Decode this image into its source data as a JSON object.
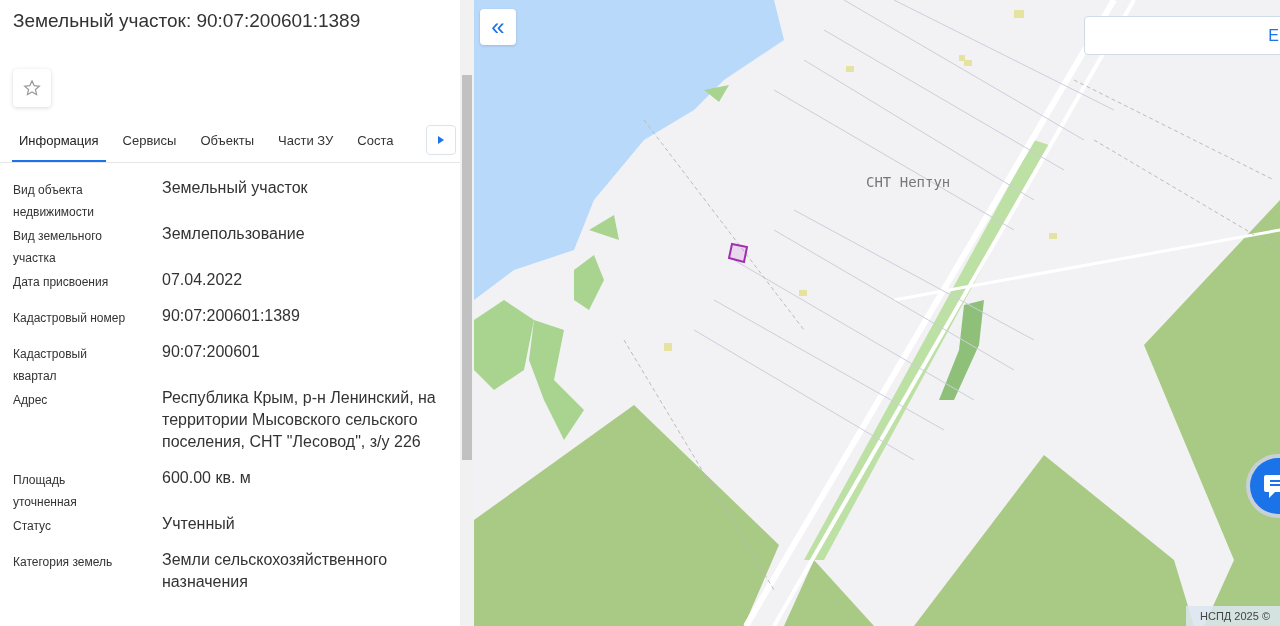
{
  "panel": {
    "title": "Земельный участок: 90:07:200601:1389",
    "tabs": [
      {
        "label": "Информация",
        "selected": true
      },
      {
        "label": "Сервисы",
        "selected": false
      },
      {
        "label": "Объекты",
        "selected": false
      },
      {
        "label": "Части ЗУ",
        "selected": false
      },
      {
        "label": "Соста",
        "selected": false
      }
    ],
    "properties": [
      {
        "label": "Вид объекта недвижимости",
        "value": "Земельный участок"
      },
      {
        "label": "Вид земельного участка",
        "value": "Землепользование"
      },
      {
        "label": "Дата присвоения",
        "value": "07.04.2022"
      },
      {
        "label": "Кадастровый номер",
        "value": "90:07:200601:1389"
      },
      {
        "label": "Кадастровый квартал",
        "value": "90:07:200601"
      },
      {
        "label": "Адрес",
        "value": "Республика Крым, р-н Ленинский, на территории Мысовского сельского поселения, СНТ \"Лесовод\", з/у 226"
      },
      {
        "label": "Площадь уточненная",
        "value": "600.00 кв. м"
      },
      {
        "label": "Статус",
        "value": "Учтенный"
      },
      {
        "label": "Категория земель",
        "value": "Земли сельскохозяйственного назначения"
      }
    ]
  },
  "map": {
    "collapse_button": "«",
    "search_text": "Е",
    "place_label": "СНТ Нептун",
    "attribution": "НСПД 2025 ©"
  }
}
